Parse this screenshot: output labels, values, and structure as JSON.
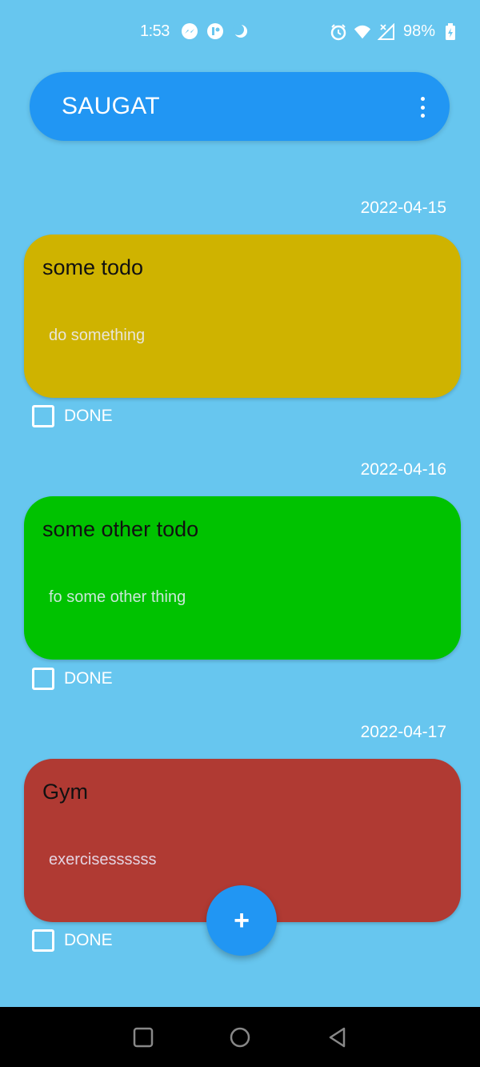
{
  "status_bar": {
    "time": "1:53",
    "battery": "98%",
    "icons_left": [
      "messenger-icon",
      "app-icon",
      "moon-icon"
    ],
    "icons_right": [
      "alarm-icon",
      "wifi-icon",
      "signal-icon",
      "battery-icon"
    ]
  },
  "app_bar": {
    "title": "SAUGAT",
    "menu_icon": "more-vert-icon"
  },
  "todos": [
    {
      "date": "2022-04-15",
      "title": "some todo",
      "description": "do something",
      "done_label": "DONE",
      "color": "#cfb300",
      "done": false
    },
    {
      "date": "2022-04-16",
      "title": "some other todo",
      "description": "fo some other thing",
      "done_label": "DONE",
      "color": "#00c200",
      "done": false
    },
    {
      "date": "2022-04-17",
      "title": "Gym",
      "description": "exercisessssss",
      "done_label": "DONE",
      "color": "#b03a33",
      "done": false
    }
  ],
  "fab": {
    "label": "+",
    "icon": "add-icon"
  },
  "nav_bar": {
    "icons": [
      "recents-icon",
      "home-icon",
      "back-icon"
    ]
  },
  "colors": {
    "background": "#67c6ef",
    "accent": "#2196f3"
  }
}
